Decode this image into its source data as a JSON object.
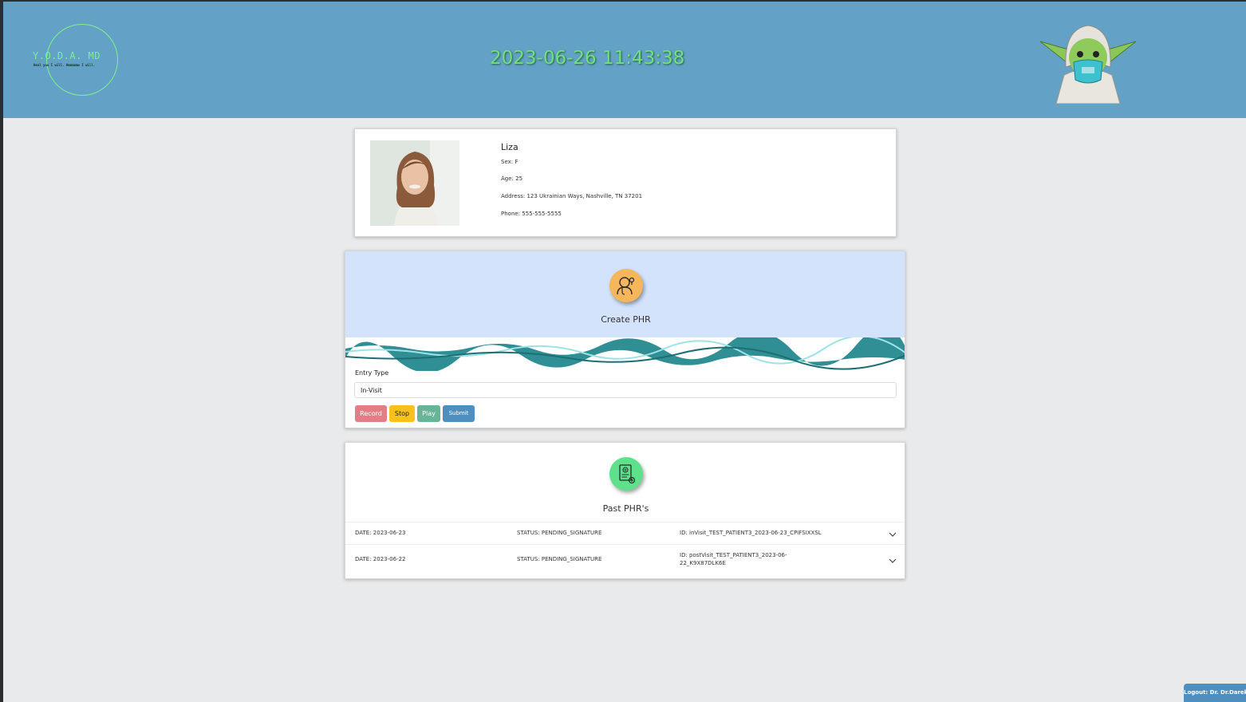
{
  "header": {
    "logo_title": "Y.O.D.A. MD",
    "logo_tagline": "Heal you I will. Hmmmmmm I will.",
    "clock": "2023-06-26 11:43:38",
    "mascot_icon": "yoda-mascot-icon"
  },
  "patient": {
    "name": "Liza",
    "sex": "Sex: F",
    "age": "Age: 25",
    "address": "Address: 123 Ukrainian Ways, Nashville, TN 37201",
    "phone": "Phone: 555-555-5555",
    "photo_icon": "patient-photo"
  },
  "create_phr": {
    "icon": "doctor-icon",
    "title": "Create PHR",
    "entry_label": "Entry Type",
    "entry_value": "In-Visit",
    "buttons": {
      "record": "Record",
      "stop": "Stop",
      "play": "Play",
      "submit": "Submit"
    },
    "colors": {
      "top_bg": "#d2e3fb",
      "icon_bg": "#f7b65c",
      "record": "#e57d87",
      "stop": "#f8c01b",
      "play": "#68b496",
      "submit": "#4f8fbf"
    }
  },
  "past_phrs": {
    "icon": "medical-document-icon",
    "title": "Past PHR's",
    "rows": [
      {
        "date": "DATE: 2023-06-23",
        "status": "STATUS: PENDING_SIGNATURE",
        "id_line1": "ID: inVisit_TEST_PATIENT3_2023-06-23_CPIFSIXXSL",
        "id_line2": ""
      },
      {
        "date": "DATE: 2023-06-22",
        "status": "STATUS: PENDING_SIGNATURE",
        "id_line1": "ID: postVisit_TEST_PATIENT3_2023-06-",
        "id_line2": "22_K9X87DLK6E"
      }
    ],
    "colors": {
      "icon_bg": "#5fe08a"
    }
  },
  "logout": "Logout: Dr. Dr.Darek",
  "colors": {
    "header_bg": "#63a2c6",
    "page_bg": "#e9eaec",
    "accent_green": "#7cf28a"
  }
}
